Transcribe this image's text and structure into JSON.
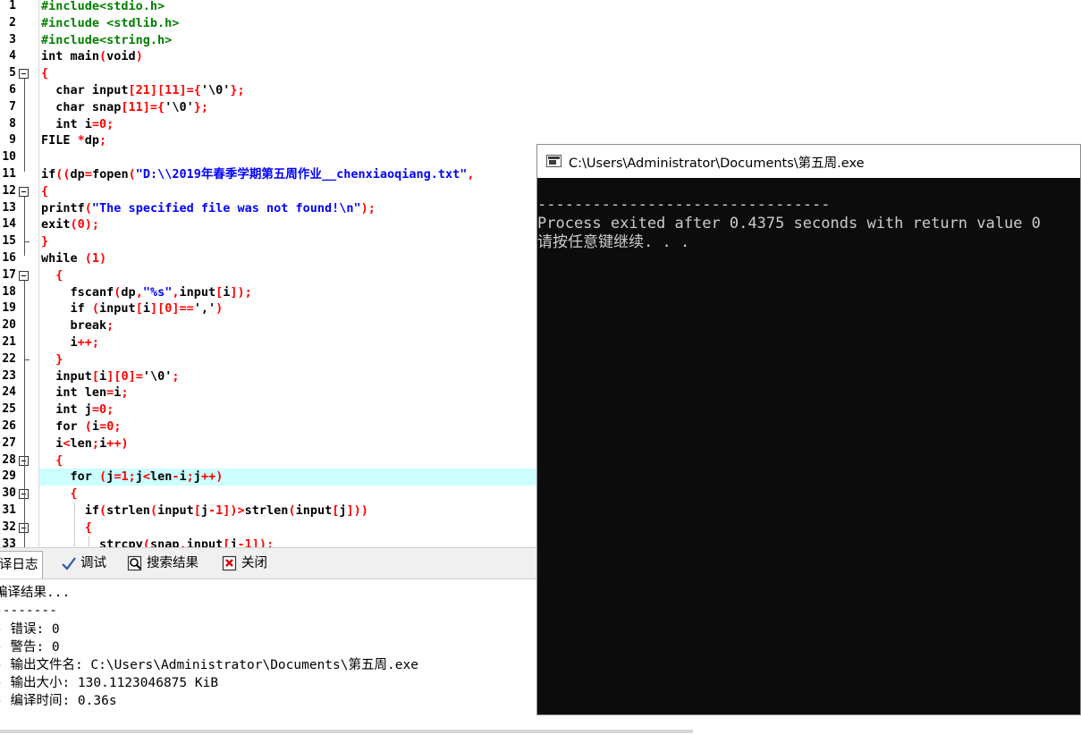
{
  "editor": {
    "line_numbers": [
      "1",
      "2",
      "3",
      "4",
      "5",
      "6",
      "7",
      "8",
      "9",
      "10",
      "11",
      "12",
      "13",
      "14",
      "15",
      "16",
      "17",
      "18",
      "19",
      "20",
      "21",
      "22",
      "23",
      "24",
      "25",
      "26",
      "27",
      "28",
      "29",
      "30",
      "31",
      "32",
      "33"
    ],
    "lines": [
      [
        {
          "t": "#include<stdio.h>",
          "c": "#008000"
        }
      ],
      [
        {
          "t": "#include <stdlib.h>",
          "c": "#008000"
        }
      ],
      [
        {
          "t": "#include<string.h>",
          "c": "#008000"
        }
      ],
      [
        {
          "t": "int main",
          "c": "#000000"
        },
        {
          "t": "(",
          "c": "#ff0000"
        },
        {
          "t": "void",
          "c": "#000000"
        },
        {
          "t": ")",
          "c": "#ff0000"
        }
      ],
      [
        {
          "t": "{",
          "c": "#ff0000"
        }
      ],
      [
        {
          "t": "  char input",
          "c": "#000000"
        },
        {
          "t": "[21][11]={",
          "c": "#ff0000"
        },
        {
          "t": "'\\0'",
          "c": "#000000"
        },
        {
          "t": "};",
          "c": "#ff0000"
        }
      ],
      [
        {
          "t": "  char snap",
          "c": "#000000"
        },
        {
          "t": "[11]={",
          "c": "#ff0000"
        },
        {
          "t": "'\\0'",
          "c": "#000000"
        },
        {
          "t": "};",
          "c": "#ff0000"
        }
      ],
      [
        {
          "t": "  int i",
          "c": "#000000"
        },
        {
          "t": "=0;",
          "c": "#ff0000"
        }
      ],
      [
        {
          "t": "FILE ",
          "c": "#000000"
        },
        {
          "t": "*",
          "c": "#ff0000"
        },
        {
          "t": "dp",
          "c": "#000000"
        },
        {
          "t": ";",
          "c": "#ff0000"
        }
      ],
      [],
      [
        {
          "t": "if",
          "c": "#000000"
        },
        {
          "t": "((",
          "c": "#ff0000"
        },
        {
          "t": "dp",
          "c": "#000000"
        },
        {
          "t": "=",
          "c": "#ff0000"
        },
        {
          "t": "fopen",
          "c": "#000000"
        },
        {
          "t": "(",
          "c": "#ff0000"
        },
        {
          "t": "\"D:\\\\2019年春季学期第五周作业__chenxiaoqiang.txt\"",
          "c": "#0000ff"
        },
        {
          "t": ",",
          "c": "#ff0000"
        }
      ],
      [
        {
          "t": "{",
          "c": "#ff0000"
        }
      ],
      [
        {
          "t": "printf",
          "c": "#000000"
        },
        {
          "t": "(",
          "c": "#ff0000"
        },
        {
          "t": "\"The specified file was not found!\\n\"",
          "c": "#0000ff"
        },
        {
          "t": ");",
          "c": "#ff0000"
        }
      ],
      [
        {
          "t": "exit",
          "c": "#000000"
        },
        {
          "t": "(0);",
          "c": "#ff0000"
        }
      ],
      [
        {
          "t": "}",
          "c": "#ff0000"
        }
      ],
      [
        {
          "t": "while ",
          "c": "#000000"
        },
        {
          "t": "(1)",
          "c": "#ff0000"
        }
      ],
      [
        {
          "t": "  {",
          "c": "#ff0000"
        }
      ],
      [
        {
          "t": "    fscanf",
          "c": "#000000"
        },
        {
          "t": "(",
          "c": "#ff0000"
        },
        {
          "t": "dp",
          "c": "#000000"
        },
        {
          "t": ",",
          "c": "#ff0000"
        },
        {
          "t": "\"%s\"",
          "c": "#0000ff"
        },
        {
          "t": ",",
          "c": "#ff0000"
        },
        {
          "t": "input",
          "c": "#000000"
        },
        {
          "t": "[",
          "c": "#ff0000"
        },
        {
          "t": "i",
          "c": "#000000"
        },
        {
          "t": "]);",
          "c": "#ff0000"
        }
      ],
      [
        {
          "t": "    if ",
          "c": "#000000"
        },
        {
          "t": "(",
          "c": "#ff0000"
        },
        {
          "t": "input",
          "c": "#000000"
        },
        {
          "t": "[",
          "c": "#ff0000"
        },
        {
          "t": "i",
          "c": "#000000"
        },
        {
          "t": "][0]==",
          "c": "#ff0000"
        },
        {
          "t": "','",
          "c": "#000000"
        },
        {
          "t": ")",
          "c": "#ff0000"
        }
      ],
      [
        {
          "t": "    break",
          "c": "#000000"
        },
        {
          "t": ";",
          "c": "#ff0000"
        }
      ],
      [
        {
          "t": "    i",
          "c": "#000000"
        },
        {
          "t": "++;",
          "c": "#ff0000"
        }
      ],
      [
        {
          "t": "  }",
          "c": "#ff0000"
        }
      ],
      [
        {
          "t": "  input",
          "c": "#000000"
        },
        {
          "t": "[",
          "c": "#ff0000"
        },
        {
          "t": "i",
          "c": "#000000"
        },
        {
          "t": "][0]=",
          "c": "#ff0000"
        },
        {
          "t": "'\\0'",
          "c": "#000000"
        },
        {
          "t": ";",
          "c": "#ff0000"
        }
      ],
      [
        {
          "t": "  int len",
          "c": "#000000"
        },
        {
          "t": "=",
          "c": "#ff0000"
        },
        {
          "t": "i",
          "c": "#000000"
        },
        {
          "t": ";",
          "c": "#ff0000"
        }
      ],
      [
        {
          "t": "  int j",
          "c": "#000000"
        },
        {
          "t": "=0;",
          "c": "#ff0000"
        }
      ],
      [
        {
          "t": "  for ",
          "c": "#000000"
        },
        {
          "t": "(",
          "c": "#ff0000"
        },
        {
          "t": "i",
          "c": "#000000"
        },
        {
          "t": "=0;",
          "c": "#ff0000"
        }
      ],
      [
        {
          "t": "  i",
          "c": "#000000"
        },
        {
          "t": "<",
          "c": "#ff0000"
        },
        {
          "t": "len",
          "c": "#000000"
        },
        {
          "t": ";",
          "c": "#ff0000"
        },
        {
          "t": "i",
          "c": "#000000"
        },
        {
          "t": "++)",
          "c": "#ff0000"
        }
      ],
      [
        {
          "t": "  {",
          "c": "#ff0000"
        }
      ],
      [
        {
          "t": "    for ",
          "c": "#000000"
        },
        {
          "t": "(",
          "c": "#ff0000"
        },
        {
          "t": "j",
          "c": "#000000"
        },
        {
          "t": "=1;",
          "c": "#ff0000"
        },
        {
          "t": "j",
          "c": "#000000"
        },
        {
          "t": "<",
          "c": "#ff0000"
        },
        {
          "t": "len",
          "c": "#000000"
        },
        {
          "t": "-",
          "c": "#ff0000"
        },
        {
          "t": "i",
          "c": "#000000"
        },
        {
          "t": ";",
          "c": "#ff0000"
        },
        {
          "t": "j",
          "c": "#000000"
        },
        {
          "t": "++)",
          "c": "#ff0000"
        }
      ],
      [
        {
          "t": "    {",
          "c": "#ff0000"
        }
      ],
      [
        {
          "t": "      if",
          "c": "#000000"
        },
        {
          "t": "(",
          "c": "#ff0000"
        },
        {
          "t": "strlen",
          "c": "#000000"
        },
        {
          "t": "(",
          "c": "#ff0000"
        },
        {
          "t": "input",
          "c": "#000000"
        },
        {
          "t": "[",
          "c": "#ff0000"
        },
        {
          "t": "j",
          "c": "#000000"
        },
        {
          "t": "-1])>",
          "c": "#ff0000"
        },
        {
          "t": "strlen",
          "c": "#000000"
        },
        {
          "t": "(",
          "c": "#ff0000"
        },
        {
          "t": "input",
          "c": "#000000"
        },
        {
          "t": "[",
          "c": "#ff0000"
        },
        {
          "t": "j",
          "c": "#000000"
        },
        {
          "t": "]))",
          "c": "#ff0000"
        }
      ],
      [
        {
          "t": "      {",
          "c": "#ff0000"
        }
      ],
      [
        {
          "t": "        strcpy",
          "c": "#000000"
        },
        {
          "t": "(",
          "c": "#ff0000"
        },
        {
          "t": "snap",
          "c": "#000000"
        },
        {
          "t": ",",
          "c": "#ff0000"
        },
        {
          "t": "input",
          "c": "#000000"
        },
        {
          "t": "[",
          "c": "#ff0000"
        },
        {
          "t": "j",
          "c": "#000000"
        },
        {
          "t": "-1]);",
          "c": "#ff0000"
        }
      ]
    ],
    "highlighted_line": 29,
    "current_line_color": "#ccffff"
  },
  "tabs": [
    {
      "label": "译日志",
      "icon": "compile-log-icon"
    },
    {
      "label": "调试",
      "icon": "debug-check-icon"
    },
    {
      "label": "搜索结果",
      "icon": "search-results-icon"
    },
    {
      "label": "关闭",
      "icon": "close-panel-icon"
    }
  ],
  "log": {
    "line1": "编译结果...",
    "line2": "--------",
    "line3": "- 错误: 0",
    "line4": "- 警告: 0",
    "line5": "- 输出文件名: C:\\Users\\Administrator\\Documents\\第五周.exe",
    "line6": "- 输出大小: 130.1123046875 KiB",
    "line7": "- 编译时间: 0.36s"
  },
  "console": {
    "title": "C:\\Users\\Administrator\\Documents\\第五周.exe",
    "separator": "--------------------------------",
    "exit_line": "Process exited after 0.4375 seconds with return value 0",
    "prompt": "请按任意键继续. . ."
  }
}
